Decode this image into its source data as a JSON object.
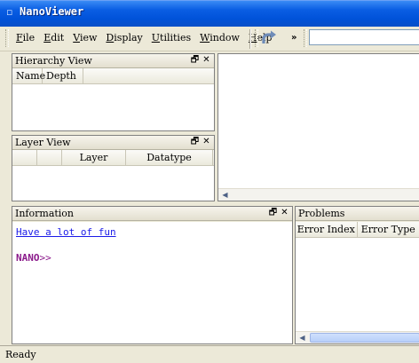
{
  "window": {
    "title": "NanoViewer"
  },
  "menu": [
    "File",
    "Edit",
    "View",
    "Display",
    "Utilities",
    "Window",
    "Help"
  ],
  "menu_mnemonic_index": [
    0,
    0,
    0,
    0,
    0,
    0,
    0
  ],
  "toolbar": {
    "overflow_label": "»",
    "address_value": ""
  },
  "hierarchy_view": {
    "title": "Hierarchy View",
    "columns": [
      "Name",
      "Depth"
    ]
  },
  "layer_view": {
    "title": "Layer View",
    "columns": [
      "",
      "",
      "Layer",
      "Datatype"
    ]
  },
  "information": {
    "title": "Information",
    "link_text": "Have a lot of fun",
    "prompt_name": "NANO",
    "prompt_symbol": ">>"
  },
  "problems": {
    "title": "Problems",
    "columns": [
      "Error Index",
      "Error Type"
    ]
  },
  "panel_buttons": {
    "restore": "🗗",
    "close": "✕"
  },
  "status": "Ready",
  "colors": {
    "titlebar": "#0a5ee3",
    "link": "#1b1be8",
    "prompt": "#8b1a8b"
  }
}
